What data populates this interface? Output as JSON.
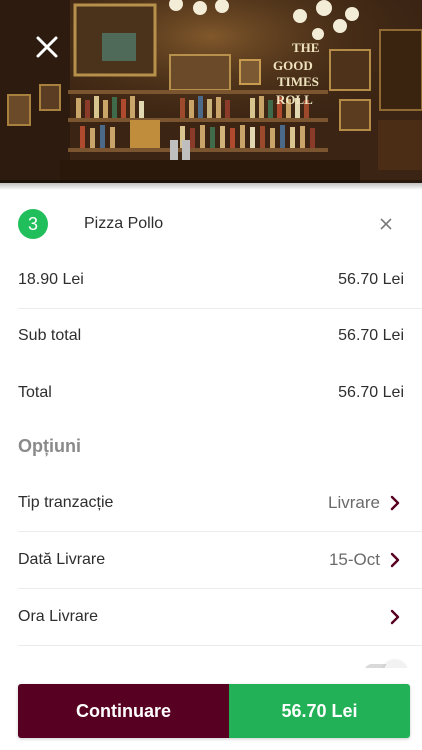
{
  "hero": {
    "close_icon": "close-icon",
    "sign_text": [
      "THE",
      "GOOD",
      "TIMES",
      "ROLL"
    ]
  },
  "order_item": {
    "quantity": "3",
    "name": "Pizza Pollo",
    "remove_icon": "close-icon",
    "unit_price": "18.90 Lei",
    "line_total": "56.70 Lei"
  },
  "summary": {
    "subtotal_label": "Sub total",
    "subtotal_value": "56.70 Lei",
    "total_label": "Total",
    "total_value": "56.70 Lei"
  },
  "options": {
    "title": "Opțiuni",
    "items": [
      {
        "label": "Tip tranzacție",
        "value": "Livrare",
        "icon": "chevron-right-icon"
      },
      {
        "label": "Dată Livrare",
        "value": "15-Oct",
        "icon": "chevron-right-icon"
      },
      {
        "label": "Ora Livrare",
        "value": "",
        "icon": "chevron-right-icon"
      }
    ]
  },
  "bottom_bar": {
    "continue_label": "Continuare",
    "total_label": "56.70 Lei"
  },
  "colors": {
    "accent_dark": "#580021",
    "accent_green": "#22b156",
    "badge_green": "#21bf5b"
  }
}
